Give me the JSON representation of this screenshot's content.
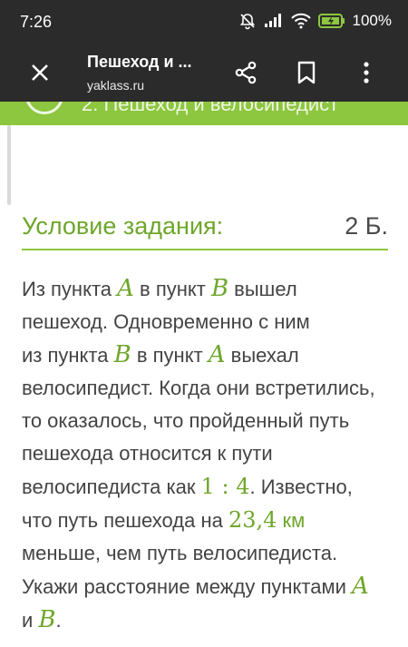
{
  "status": {
    "time": "7:26",
    "battery": "100%"
  },
  "appbar": {
    "title": "Пешеход и ...",
    "subtitle": "yaklass.ru"
  },
  "section": {
    "label": "2. Пешеход и велосипедист"
  },
  "condition": {
    "title": "Условие задания:",
    "points": "2 Б."
  },
  "task": {
    "l1": {
      "t1": "Из пункта ",
      "m1": "A",
      "t2": " в пункт ",
      "m2": "B",
      "t3": " вышел"
    },
    "l2": "пешеход. Одновременно с ним",
    "l3": {
      "t1": "из пункта ",
      "m1": "B",
      "t2": " в пункт ",
      "m2": "A",
      "t3": " выехал"
    },
    "l4": "велосипедист. Когда они встретились,",
    "l5": "то оказалось, что пройденный путь",
    "l6": "пешехода относится к пути",
    "l7": {
      "t1": "велосипедиста как ",
      "ratio": "1 : 4",
      "t2": ". Известно,"
    },
    "l8": {
      "t1": "что путь пешехода на ",
      "num": "23,4",
      "unit": " км"
    },
    "l9": "меньше, чем путь велосипедиста.",
    "l10": {
      "t1": "Укажи расстояние между пунктами ",
      "m1": "A"
    },
    "l11": {
      "t1": "и ",
      "m1": "B",
      "t2": "."
    }
  },
  "icons": {
    "close": "close-icon",
    "share": "share-icon",
    "bookmark": "bookmark-icon",
    "more": "more-vertical-icon"
  },
  "colors": {
    "accent": "#8dc63f",
    "math": "#6ea62b",
    "bar": "#2b2b2b"
  }
}
